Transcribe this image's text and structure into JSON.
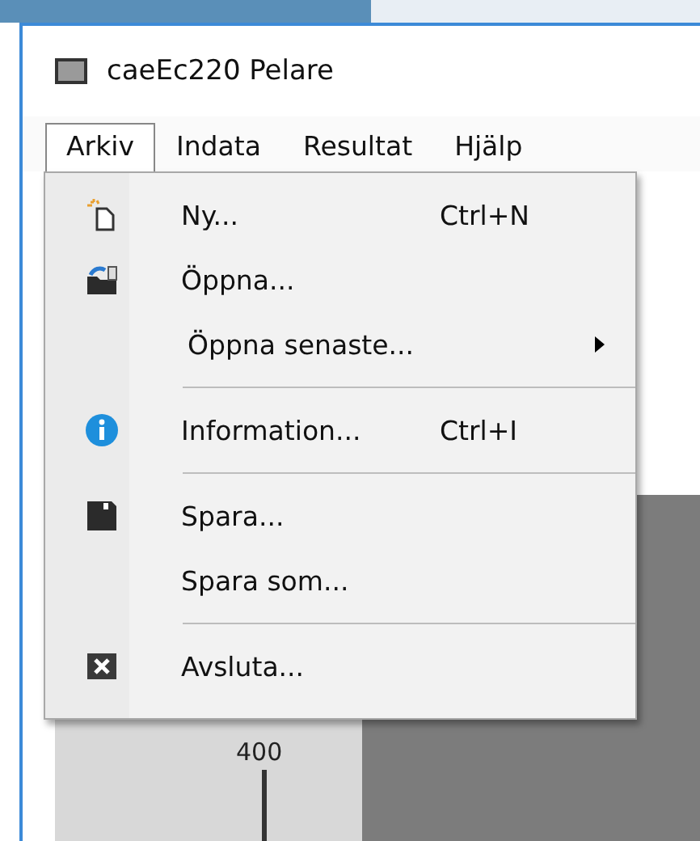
{
  "window": {
    "title": "caeEc220 Pelare"
  },
  "menubar": [
    {
      "label": "Arkiv",
      "selected": true
    },
    {
      "label": "Indata",
      "selected": false
    },
    {
      "label": "Resultat",
      "selected": false
    },
    {
      "label": "Hjälp",
      "selected": false
    }
  ],
  "menu": [
    {
      "kind": "item",
      "label": "Ny...",
      "shortcut": "Ctrl+N",
      "submenu": false
    },
    {
      "kind": "item",
      "label": "Öppna...",
      "submenu": false
    },
    {
      "kind": "item",
      "label": "Öppna senaste...",
      "submenu": true
    },
    {
      "kind": "separator"
    },
    {
      "kind": "item",
      "label": "Information...",
      "shortcut": "Ctrl+I",
      "submenu": false
    },
    {
      "kind": "separator"
    },
    {
      "kind": "item",
      "label": "Spara...",
      "submenu": false
    },
    {
      "kind": "item",
      "label": "Spara som...",
      "submenu": false
    },
    {
      "kind": "separator"
    },
    {
      "kind": "item",
      "label": "Avsluta...",
      "submenu": false
    }
  ],
  "canvas": {
    "axis_label": "400"
  }
}
